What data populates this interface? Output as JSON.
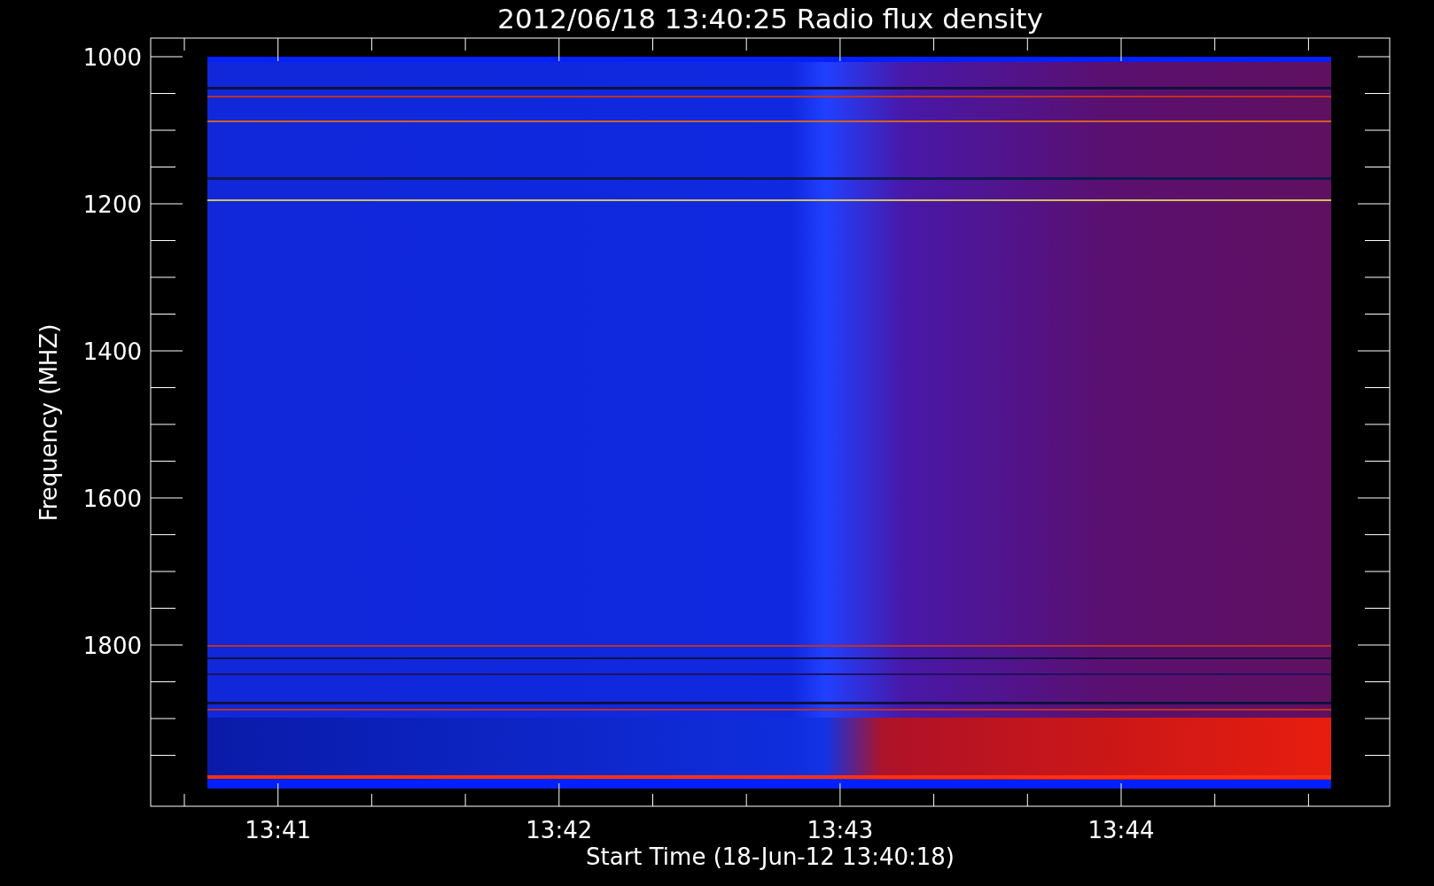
{
  "title": "2012/06/18 13:40:25 Radio flux density",
  "y_axis": {
    "label": "Frequency (MHZ)",
    "tick_labels": [
      "1000",
      "1200",
      "1400",
      "1600",
      "1800"
    ]
  },
  "x_axis": {
    "label": "Start Time (18-Jun-12 13:40:18)",
    "tick_labels": [
      "13:41",
      "13:42",
      "13:43",
      "13:44"
    ]
  }
}
